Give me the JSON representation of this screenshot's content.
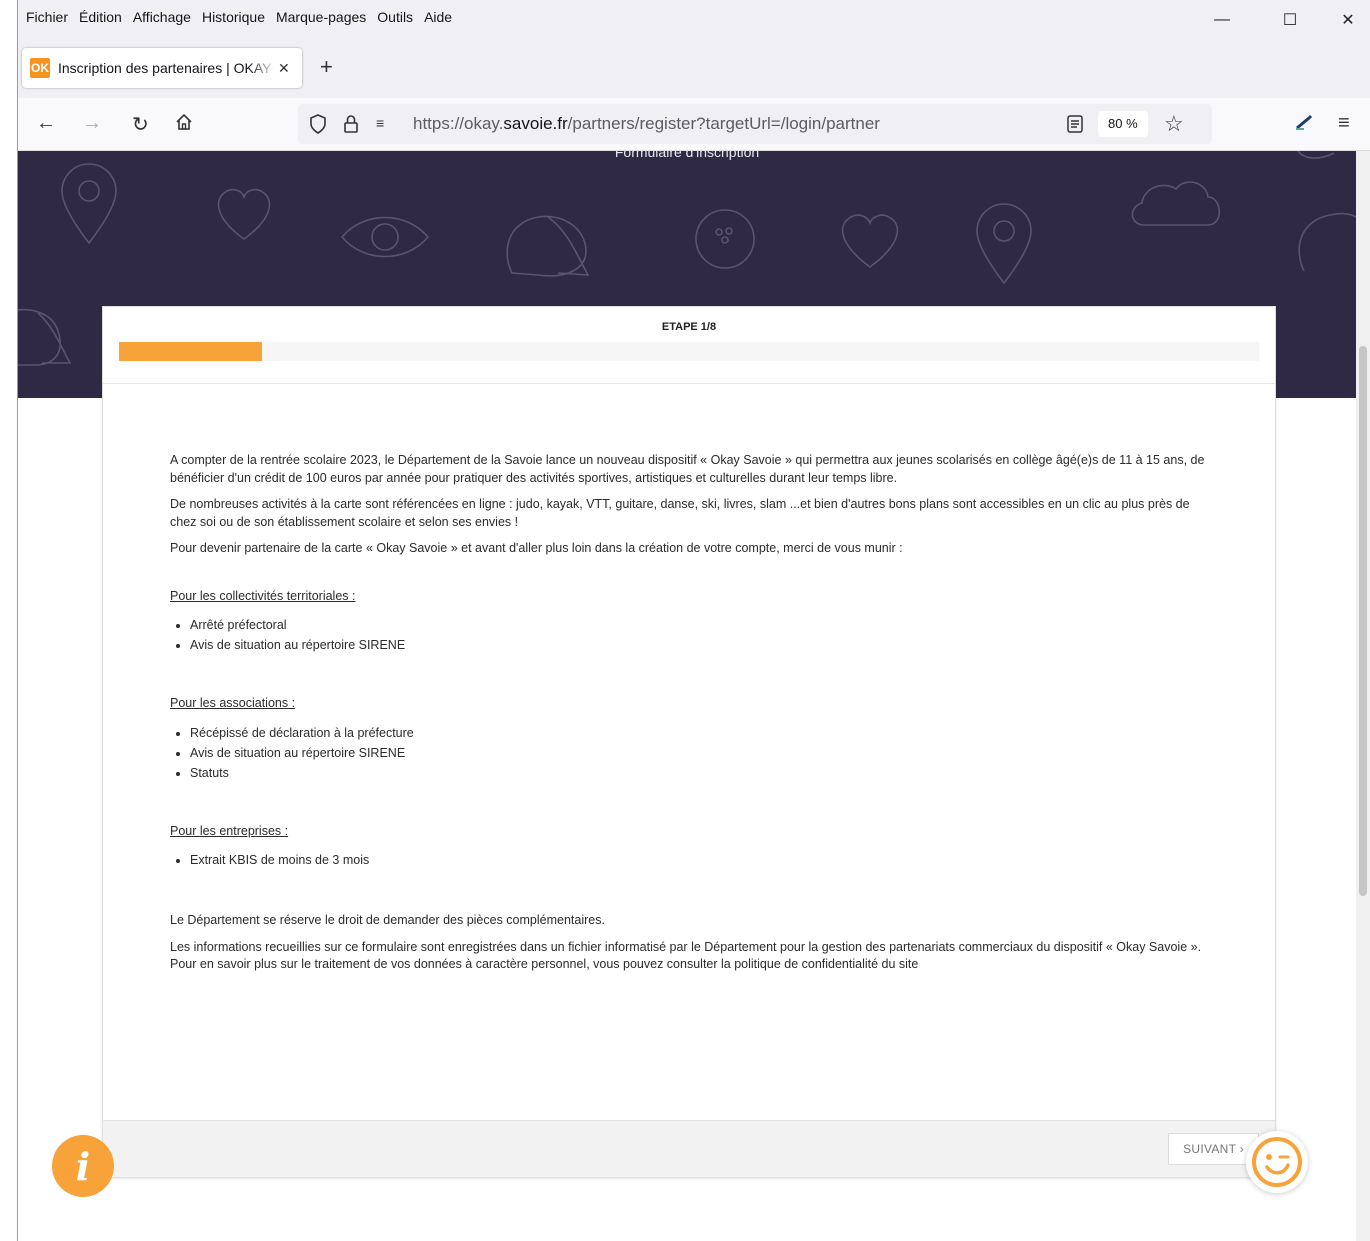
{
  "browser": {
    "menus": [
      "Fichier",
      "Édition",
      "Affichage",
      "Historique",
      "Marque-pages",
      "Outils",
      "Aide"
    ],
    "tab_title": "Inscription des partenaires | OKAY Savoie",
    "tab_favicon": "OK",
    "url_prefix": "https://okay.",
    "url_domain": "savoie.fr",
    "url_path": "/partners/register?targetUrl=/login/partner",
    "zoom": "80 %"
  },
  "hero": {
    "title": "Formulaire d'inscription",
    "bg_color": "#2f2944"
  },
  "form": {
    "step": "ETAPE 1/8",
    "progress_fraction": 0.125,
    "accent_color": "#f7a33a",
    "intro_1": "A compter de la rentrée scolaire 2023, le Département de la Savoie lance un nouveau dispositif « Okay Savoie » qui permettra aux jeunes scolarisés en collège âgé(e)s de 11 à 15 ans, de bénéficier d'un crédit de 100 euros par année pour pratiquer des activités sportives, artistiques et culturelles durant leur temps libre.",
    "intro_2": "De nombreuses activités à la carte sont référencées en ligne : judo, kayak, VTT, guitare, danse, ski, livres, slam ...et bien d'autres bons plans sont accessibles en un clic au plus près de chez soi ou de son établissement scolaire et selon ses envies !",
    "intro_3": "Pour devenir partenaire de la carte « Okay Savoie » et avant d'aller plus loin dans la création de votre compte, merci de vous munir :",
    "sections": [
      {
        "title": "Pour les collectivités territoriales :",
        "items": [
          "Arrêté préfectoral",
          "Avis de situation au répertoire SIRENE"
        ]
      },
      {
        "title": "Pour les associations :",
        "items": [
          "Récépissé de déclaration à la préfecture",
          "Avis de situation au répertoire SIRENE",
          "Statuts"
        ]
      },
      {
        "title": "Pour les entreprises :",
        "items": [
          "Extrait KBIS de moins de 3 mois"
        ]
      }
    ],
    "outro_1": "Le Département se réserve le droit de demander des pièces complémentaires.",
    "outro_2": "Les informations recueillies sur ce formulaire sont enregistrées dans un fichier informatisé par le Département pour la gestion des partenariats commerciaux du dispositif « Okay Savoie ». Pour en savoir plus sur le traitement de vos données à caractère personnel, vous pouvez consulter la politique de confidentialité du site",
    "next_label": "SUIVANT ›"
  },
  "widgets": {
    "info_glyph": "i"
  }
}
